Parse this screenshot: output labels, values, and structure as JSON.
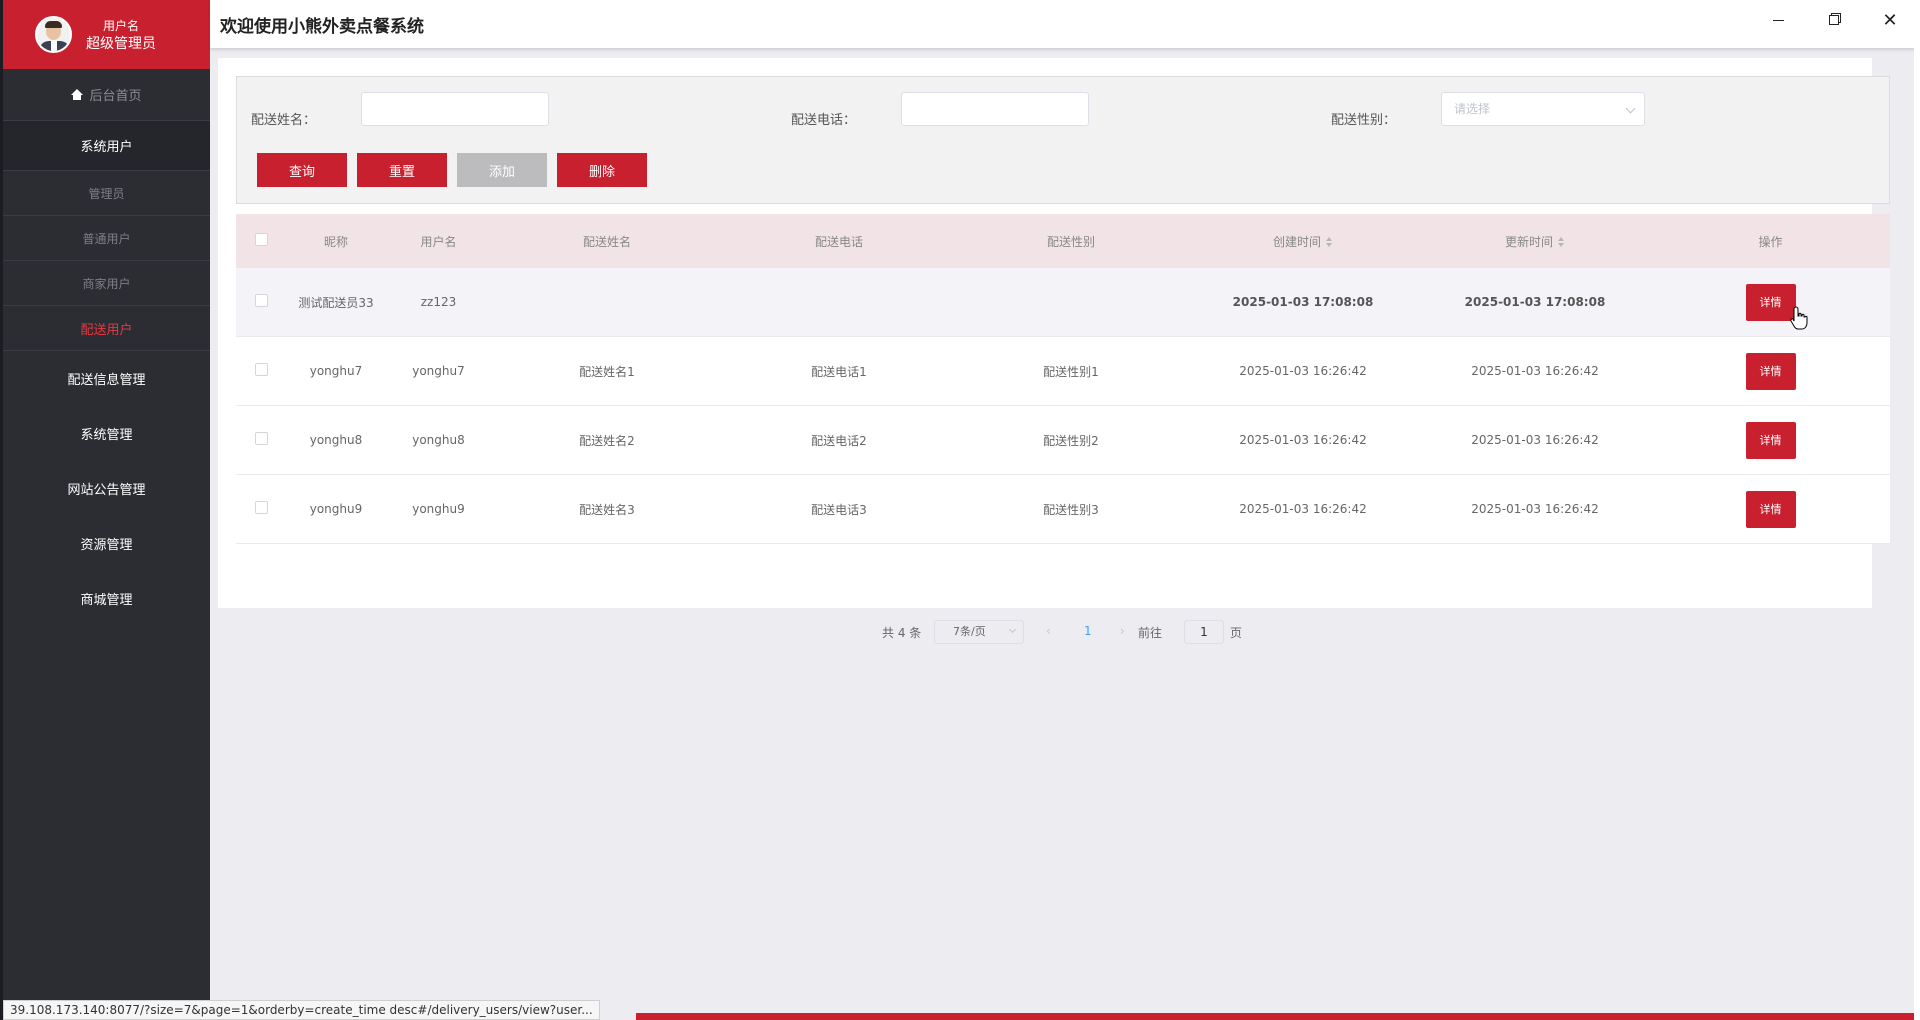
{
  "app": {
    "title": "欢迎使用小熊外卖点餐系统"
  },
  "user": {
    "name_label": "用户名",
    "role": "超级管理员"
  },
  "sidebar": {
    "home": "后台首页",
    "group": "系统用户",
    "subs": [
      "管理员",
      "普通用户",
      "商家用户",
      "配送用户"
    ],
    "active_sub": "配送用户",
    "menus": [
      "配送信息管理",
      "系统管理",
      "网站公告管理",
      "资源管理",
      "商城管理"
    ]
  },
  "search": {
    "name_label": "配送姓名：",
    "phone_label": "配送电话：",
    "gender_label": "配送性别：",
    "gender_placeholder": "请选择",
    "buttons": {
      "query": "查询",
      "reset": "重置",
      "add": "添加",
      "delete": "删除"
    }
  },
  "table": {
    "headers": [
      "昵称",
      "用户名",
      "配送姓名",
      "配送电话",
      "配送性别",
      "创建时间",
      "更新时间",
      "操作"
    ],
    "rows": [
      {
        "nickname": "测试配送员33",
        "username": "zz123",
        "name": "",
        "phone": "",
        "gender": "",
        "created": "2025-01-03 17:08:08",
        "updated": "2025-01-03 17:08:08",
        "action": "详情"
      },
      {
        "nickname": "yonghu7",
        "username": "yonghu7",
        "name": "配送姓名1",
        "phone": "配送电话1",
        "gender": "配送性别1",
        "created": "2025-01-03 16:26:42",
        "updated": "2025-01-03 16:26:42",
        "action": "详情"
      },
      {
        "nickname": "yonghu8",
        "username": "yonghu8",
        "name": "配送姓名2",
        "phone": "配送电话2",
        "gender": "配送性别2",
        "created": "2025-01-03 16:26:42",
        "updated": "2025-01-03 16:26:42",
        "action": "详情"
      },
      {
        "nickname": "yonghu9",
        "username": "yonghu9",
        "name": "配送姓名3",
        "phone": "配送电话3",
        "gender": "配送性别3",
        "created": "2025-01-03 16:26:42",
        "updated": "2025-01-03 16:26:42",
        "action": "详情"
      }
    ]
  },
  "pagination": {
    "total": "共 4 条",
    "page_size": "7条/页",
    "current_page": "1",
    "goto_label": "前往",
    "goto_value": "1",
    "page_unit": "页"
  },
  "status_url": "39.108.173.140:8077/?size=7&page=1&orderby=create_time desc#/delivery_users/view?user...",
  "colors": {
    "accent": "#c9202f",
    "sidebar": "#2c2d33",
    "header_row": "#f2e3e7"
  }
}
